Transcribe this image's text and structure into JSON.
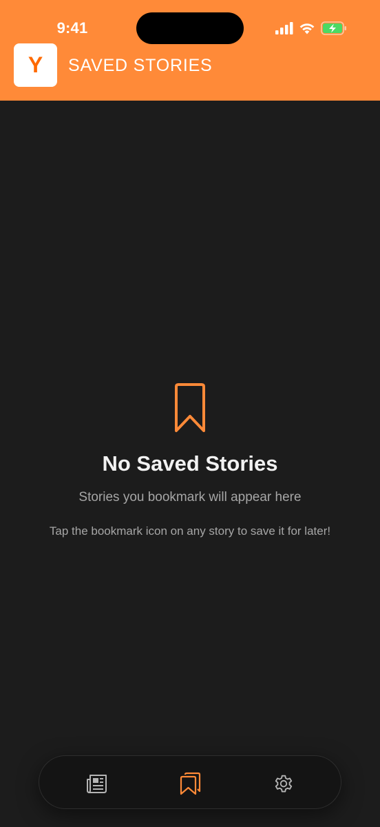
{
  "status_bar": {
    "time": "9:41",
    "icons": [
      "cellular-signal-icon",
      "wifi-icon",
      "battery-charging-icon"
    ]
  },
  "header": {
    "logo_letter": "Y",
    "title": "SAVED STORIES",
    "background_color": "#ff8a38"
  },
  "empty_state": {
    "icon": "bookmark-icon",
    "title": "No Saved Stories",
    "subtitle": "Stories you bookmark will appear here",
    "hint": "Tap the bookmark icon on any story to save it for later!"
  },
  "tab_bar": {
    "tabs": [
      {
        "icon": "newspaper-icon",
        "active": false
      },
      {
        "icon": "bookmarks-icon",
        "active": true
      },
      {
        "icon": "gear-icon",
        "active": false
      }
    ],
    "active_color": "#ff8a38",
    "inactive_color": "#b5b5b5"
  },
  "colors": {
    "accent": "#ff8a38",
    "background": "#1c1c1c"
  }
}
